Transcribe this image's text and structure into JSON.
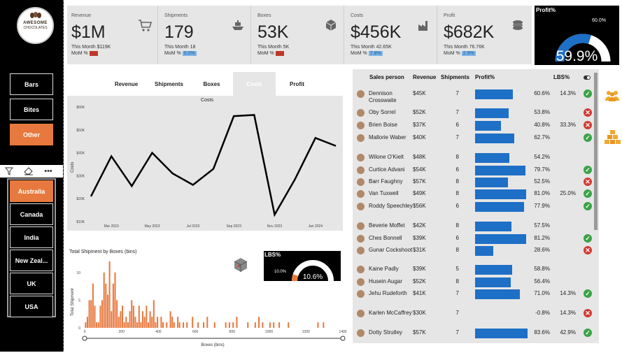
{
  "brand": {
    "line1": "AWESOME",
    "line2": "CHOCOLATES"
  },
  "nav": {
    "products": [
      "Bars",
      "Bites",
      "Other"
    ],
    "active_product": "Other",
    "countries": [
      "Australia",
      "Canada",
      "India",
      "New Zeal...",
      "UK",
      "USA"
    ],
    "active_country": "Australia"
  },
  "kpis": [
    {
      "label": "Revenue",
      "value": "$1M",
      "this_month": "This Month $119K",
      "mom_label": "MoM %",
      "mom": "-...",
      "mom_state": "neg",
      "icon": "cart-icon"
    },
    {
      "label": "Shipments",
      "value": "179",
      "this_month": "This Month 18",
      "mom_label": "MoM %",
      "mom": "0.0%",
      "mom_state": "pos",
      "icon": "ship-icon"
    },
    {
      "label": "Boxes",
      "value": "53K",
      "this_month": "This Month 5K",
      "mom_label": "MoM %",
      "mom": "-...",
      "mom_state": "neg",
      "icon": "box-icon"
    },
    {
      "label": "Costs",
      "value": "$456K",
      "this_month": "This Month 42.65K",
      "mom_label": "MoM %",
      "mom": "7.8%",
      "mom_state": "pos",
      "icon": "factory-icon"
    },
    {
      "label": "Profit",
      "value": "$682K",
      "this_month": "This Month 76.76K",
      "mom_label": "MoM %",
      "mom": "2.9%",
      "mom_state": "pos",
      "icon": "coins-icon"
    }
  ],
  "profit_gauge": {
    "title": "Profit%",
    "value": "59.9%",
    "target": "60.0%",
    "fraction": 0.599
  },
  "tabs": [
    "Revenue",
    "Shipments",
    "Boxes",
    "Costs",
    "Profit"
  ],
  "active_tab": "Costs",
  "chart_data": [
    {
      "type": "line",
      "title": "Costs",
      "ylabel": "Costs",
      "x": [
        "2023-02",
        "2023-03",
        "2023-04",
        "2023-05",
        "2023-06",
        "2023-07",
        "2023-08",
        "2023-09",
        "2023-10",
        "2023-11",
        "2023-12",
        "2024-01",
        "2024-02"
      ],
      "values": [
        21,
        38.5,
        25.5,
        40,
        31,
        26,
        33,
        56,
        56.5,
        13,
        28.5,
        46.5,
        43
      ],
      "ylim": [
        10,
        60
      ],
      "yticks": [
        "$10K",
        "$20K",
        "$30K",
        "$40K",
        "$50K",
        "$60K"
      ],
      "xticks": [
        "Mar 2023",
        "May 2023",
        "Jul 2023",
        "Sep 2023",
        "Nov 2023",
        "Jan 2024"
      ],
      "color": "#000000"
    },
    {
      "type": "bar",
      "title": "Total Shipment by Boxes (bins)",
      "xlabel": "Boxes (bins)",
      "ylabel": "Total Shipment",
      "xlim": [
        0,
        1400
      ],
      "ylim": [
        0,
        12
      ],
      "yticks": [
        "0",
        "5",
        "10"
      ],
      "xticks": [
        "0",
        "200",
        "400",
        "600",
        "800",
        "1000",
        "1200",
        "1400"
      ],
      "bin_width": 10,
      "x": [
        0,
        10,
        20,
        30,
        40,
        50,
        60,
        70,
        80,
        90,
        100,
        110,
        120,
        130,
        140,
        150,
        160,
        170,
        180,
        190,
        200,
        210,
        220,
        230,
        240,
        250,
        260,
        270,
        280,
        290,
        300,
        310,
        320,
        330,
        340,
        350,
        360,
        370,
        380,
        390,
        410,
        420,
        440,
        460,
        470,
        480,
        500,
        510,
        530,
        550,
        580,
        610,
        640,
        660,
        700,
        760,
        780,
        800,
        820,
        880,
        920,
        940,
        960,
        1000,
        1020,
        1050,
        1100,
        1260,
        1290
      ],
      "values": [
        1,
        2,
        5,
        5,
        8,
        4,
        1,
        1,
        4,
        5,
        10,
        8,
        6,
        12,
        3,
        8,
        10,
        5,
        2,
        3,
        4,
        1,
        2,
        1,
        3,
        5,
        4,
        2,
        1,
        4,
        1,
        3,
        2,
        4,
        1,
        3,
        2,
        5,
        1,
        2,
        2,
        1,
        1,
        3,
        2,
        1,
        2,
        1,
        1,
        1,
        2,
        1,
        1,
        2,
        1,
        1,
        1,
        1,
        2,
        1,
        1,
        2,
        1,
        1,
        1,
        1,
        1,
        1,
        1
      ],
      "color": "#e8793e"
    }
  ],
  "lbs_gauge": {
    "title": "LBS%",
    "value": "10.6%",
    "target": "10.0%",
    "fraction": 0.106
  },
  "table": {
    "headers": [
      "Sales person",
      "Revenue",
      "Shipments",
      "Profit%",
      "LBS%"
    ],
    "rows": [
      {
        "name": "Dennison Crosswaite",
        "revenue": "$45K",
        "shipments": "7",
        "profit_pct": "60.6%",
        "profit": 60.6,
        "lbs": "14.3%",
        "status": "ok"
      },
      {
        "name": "Oby Sorrel",
        "revenue": "$52K",
        "shipments": "7",
        "profit_pct": "53.8%",
        "profit": 53.8,
        "lbs": "",
        "status": "bad"
      },
      {
        "name": "Brien Boise",
        "revenue": "$37K",
        "shipments": "6",
        "profit_pct": "40.8%",
        "profit": 40.8,
        "lbs": "33.3%",
        "status": "bad"
      },
      {
        "name": "Mallorie Waber",
        "revenue": "$40K",
        "shipments": "7",
        "profit_pct": "62.7%",
        "profit": 62.7,
        "lbs": "",
        "status": "ok"
      },
      {
        "name": "Wilone O'Kielt",
        "revenue": "$48K",
        "shipments": "8",
        "profit_pct": "54.2%",
        "profit": 54.2,
        "lbs": "",
        "status": ""
      },
      {
        "name": "Curtice Advani",
        "revenue": "$54K",
        "shipments": "6",
        "profit_pct": "79.7%",
        "profit": 79.7,
        "lbs": "",
        "status": "ok"
      },
      {
        "name": "Barr Faughny",
        "revenue": "$57K",
        "shipments": "8",
        "profit_pct": "52.5%",
        "profit": 52.5,
        "lbs": "",
        "status": "bad"
      },
      {
        "name": "Van Tuxwell",
        "revenue": "$49K",
        "shipments": "8",
        "profit_pct": "81.0%",
        "profit": 81.0,
        "lbs": "25.0%",
        "status": "ok"
      },
      {
        "name": "Roddy Speechley",
        "revenue": "$56K",
        "shipments": "6",
        "profit_pct": "77.9%",
        "profit": 77.9,
        "lbs": "",
        "status": "ok"
      },
      {
        "name": "Beverie Moffet",
        "revenue": "$42K",
        "shipments": "8",
        "profit_pct": "57.5%",
        "profit": 57.5,
        "lbs": "",
        "status": ""
      },
      {
        "name": "Ches Bonnell",
        "revenue": "$39K",
        "shipments": "6",
        "profit_pct": "81.2%",
        "profit": 81.2,
        "lbs": "",
        "status": "ok"
      },
      {
        "name": "Gunar Cockshoot",
        "revenue": "$31K",
        "shipments": "8",
        "profit_pct": "28.6%",
        "profit": 28.6,
        "lbs": "",
        "status": "bad"
      },
      {
        "name": "Kaine Padly",
        "revenue": "$39K",
        "shipments": "5",
        "profit_pct": "58.8%",
        "profit": 58.8,
        "lbs": "",
        "status": ""
      },
      {
        "name": "Husein Augar",
        "revenue": "$52K",
        "shipments": "8",
        "profit_pct": "56.4%",
        "profit": 56.4,
        "lbs": "",
        "status": ""
      },
      {
        "name": "Jehu Rudeforth",
        "revenue": "$41K",
        "shipments": "7",
        "profit_pct": "71.0%",
        "profit": 71.0,
        "lbs": "14.3%",
        "status": "ok"
      },
      {
        "name": "Karlen McCaffrey",
        "revenue": "$30K",
        "shipments": "7",
        "profit_pct": "-0.8%",
        "profit": -0.8,
        "lbs": "14.3%",
        "status": "bad"
      },
      {
        "name": "Dotty Strutley",
        "revenue": "$57K",
        "shipments": "7",
        "profit_pct": "83.6%",
        "profit": 83.6,
        "lbs": "42.9%",
        "status": "ok"
      }
    ]
  },
  "colors": {
    "accent": "#e8793e",
    "bar_blue": "#1e6fc6",
    "panel": "#e6e6e6"
  }
}
